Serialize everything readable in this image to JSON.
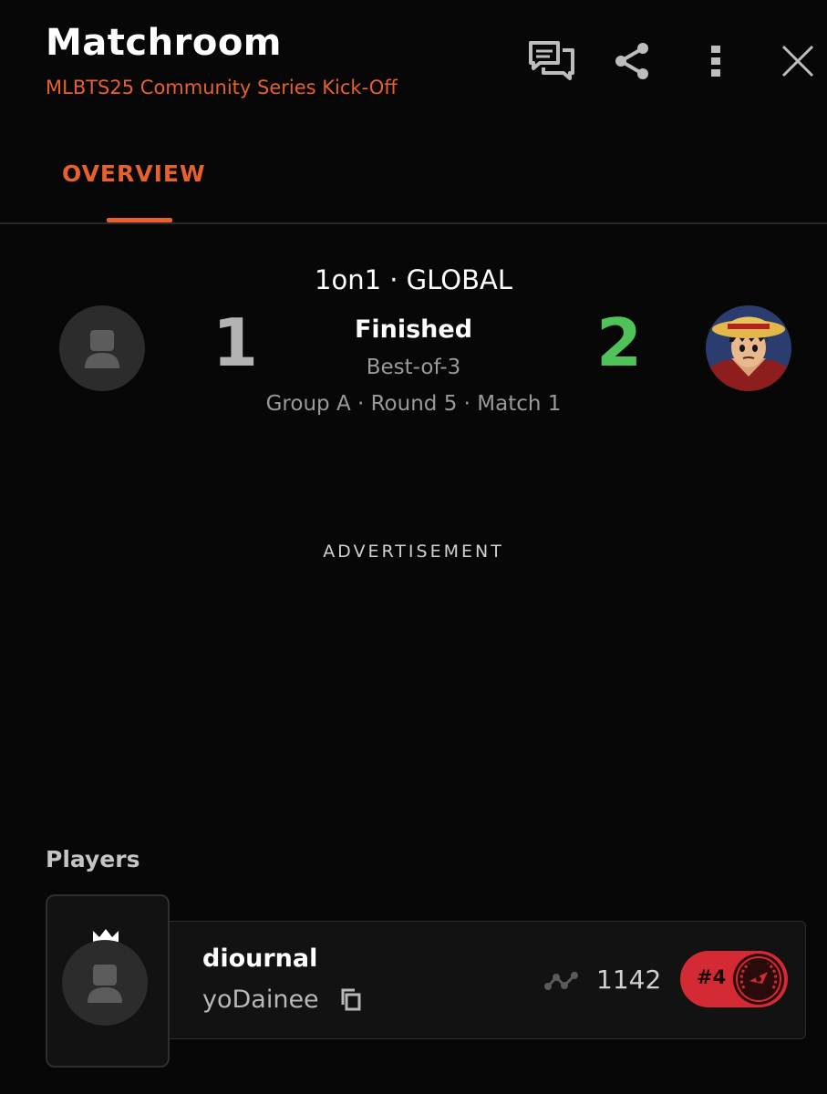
{
  "header": {
    "title": "Matchroom",
    "subtitle": "MLBTS25 Community Series Kick-Off",
    "icons": [
      "chat-icon",
      "share-icon",
      "more-vertical-icon",
      "close-icon"
    ]
  },
  "tabs": [
    {
      "label": "OVERVIEW",
      "active": true
    }
  ],
  "match": {
    "format": "1on1 · GLOBAL",
    "status": "Finished",
    "best_of": "Best-of-3",
    "group_info": "Group A · Round 5 · Match 1",
    "score_left": "1",
    "score_right": "2"
  },
  "advertisement": "ADVERTISEMENT",
  "players": {
    "heading": "Players",
    "list": [
      {
        "name": "diournal",
        "handle": "yoDainee",
        "rating": "1142",
        "rank": "#4"
      }
    ]
  },
  "colors": {
    "accent": "#e8602c",
    "winner_score": "#4fc25a",
    "loser_score": "#b3b3b3",
    "rank_badge": "#d42a33",
    "background": "#070707"
  }
}
